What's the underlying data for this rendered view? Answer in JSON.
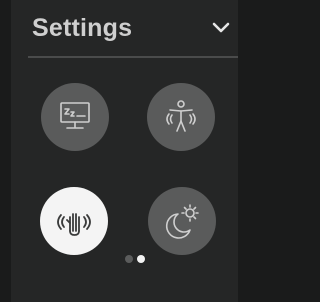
{
  "panel": {
    "title": "Settings",
    "collapse_icon": "chevron-down-icon"
  },
  "tiles": [
    {
      "id": "sleep",
      "icon": "computer-sleep-icon",
      "active": false
    },
    {
      "id": "body",
      "icon": "body-motion-icon",
      "active": false
    },
    {
      "id": "wave",
      "icon": "hand-wave-gesture-icon",
      "active": true
    },
    {
      "id": "night",
      "icon": "moon-sun-icon",
      "active": false
    }
  ],
  "pager": {
    "count": 2,
    "current": 2
  },
  "colors": {
    "background": "#1a1b1b",
    "panel": "#252626",
    "tile_inactive": "#5a5b5b",
    "tile_active": "#f4f4f4",
    "icon_inactive": "#cfcfcf",
    "icon_active": "#3a3b3b",
    "title": "#cfcfcf"
  }
}
